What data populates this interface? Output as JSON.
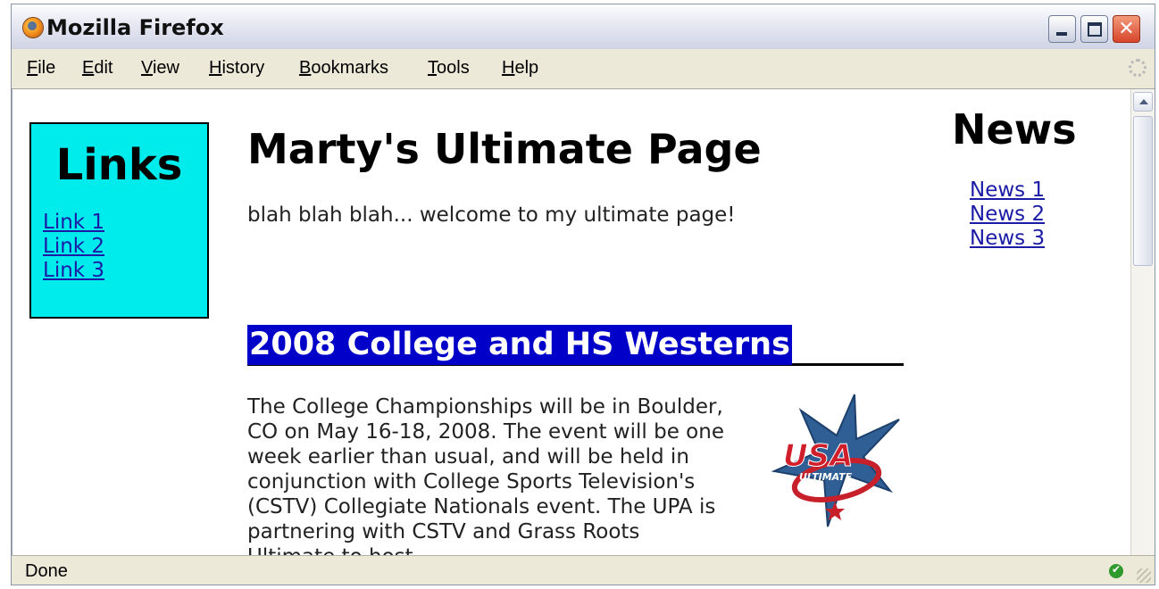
{
  "window": {
    "title": "Mozilla Firefox"
  },
  "menu": [
    "File",
    "Edit",
    "View",
    "History",
    "Bookmarks",
    "Tools",
    "Help"
  ],
  "status": {
    "text": "Done"
  },
  "page": {
    "title": "Marty's Ultimate Page",
    "intro": "blah blah blah... welcome to my ultimate page!",
    "links_heading": "Links",
    "links": [
      "Link 1",
      "Link 2",
      "Link 3"
    ],
    "news_heading": "News",
    "news": [
      "News 1",
      "News 2",
      "News 3"
    ],
    "section_heading": "2008 College and HS Westerns",
    "article_text": "The College Championships will be in Boulder, CO on May 16-18, 2008. The event will be one week earlier than usual, and will be held in conjunction with College Sports Television's (CSTV) Collegiate Nationals event. The UPA is partnering with CSTV and Grass Roots Ultimate to host",
    "logo": {
      "text_top": "USA",
      "text_bottom": "ULTIMATE",
      "icon": "usa-ultimate-star-logo"
    }
  },
  "colors": {
    "links_box_bg": "#00ecec",
    "section_heading_bg": "#0000c8",
    "link_color": "#1b1ba6"
  }
}
